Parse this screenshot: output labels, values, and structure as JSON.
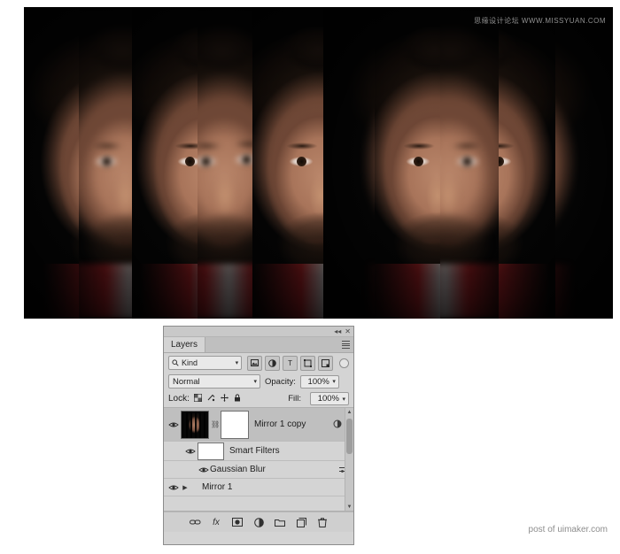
{
  "image": {
    "watermark": "思缘设计论坛  WWW.MISSYUAN.COM",
    "description": "Mirrored portrait of a man split into vertical strips, alternating sharp and blurred",
    "strips": [
      {
        "blurred": false,
        "offset": -30
      },
      {
        "blurred": true,
        "offset": -12
      },
      {
        "blurred": false,
        "offset": 10
      },
      {
        "blurred": true,
        "offset": 30
      },
      {
        "blurred": false,
        "offset": 52
      },
      {
        "blurred": true,
        "offset": 74
      },
      {
        "blurred": false,
        "offset": 96
      }
    ]
  },
  "credit": "post of uimaker.com",
  "panel": {
    "tab_label": "Layers",
    "collapse_icon": "chevron-double-left",
    "close_icon": "close",
    "menu_icon": "panel-menu",
    "filter": {
      "search_icon": "search-icon",
      "kind_value": "Kind",
      "caret": "▾",
      "icons": [
        "pixel-layer-icon",
        "adjustment-layer-icon",
        "type-layer-icon",
        "shape-layer-icon",
        "smart-object-icon"
      ],
      "toggle": "filter-toggle"
    },
    "blend": {
      "mode": "Normal",
      "caret": "▾",
      "opacity_label": "Opacity:",
      "opacity_value": "100%"
    },
    "lock": {
      "label": "Lock:",
      "icons": [
        "lock-transparent-pixels",
        "lock-image-pixels",
        "lock-position",
        "lock-all"
      ],
      "fill_label": "Fill:",
      "fill_value": "100%"
    },
    "layers": [
      {
        "name": "Mirror 1 copy",
        "visible": true,
        "selected": true,
        "has_mask": true,
        "linked": true,
        "smart_object": true,
        "expanded": true,
        "right_icons": [
          "smart-object-badge",
          "expand-arrow"
        ]
      },
      {
        "name": "Smart Filters",
        "visible": true,
        "type": "smart-filters",
        "has_mask": true
      },
      {
        "name": "Gaussian Blur",
        "visible": true,
        "type": "filter-effect",
        "right_icons": [
          "filter-options-icon"
        ]
      },
      {
        "name": "Mirror 1",
        "visible": true,
        "selected": false,
        "expandable": true
      }
    ],
    "footer_icons": [
      "link-layers-icon",
      "layer-style-fx-icon",
      "add-layer-mask-icon",
      "adjustment-layer-icon",
      "new-group-icon",
      "new-layer-icon",
      "delete-layer-icon"
    ],
    "footer_labels": [
      "",
      "fx",
      "",
      "",
      "",
      "",
      ""
    ],
    "scrollbar": {
      "up_arrow": "▲",
      "down_arrow": "▼"
    }
  }
}
